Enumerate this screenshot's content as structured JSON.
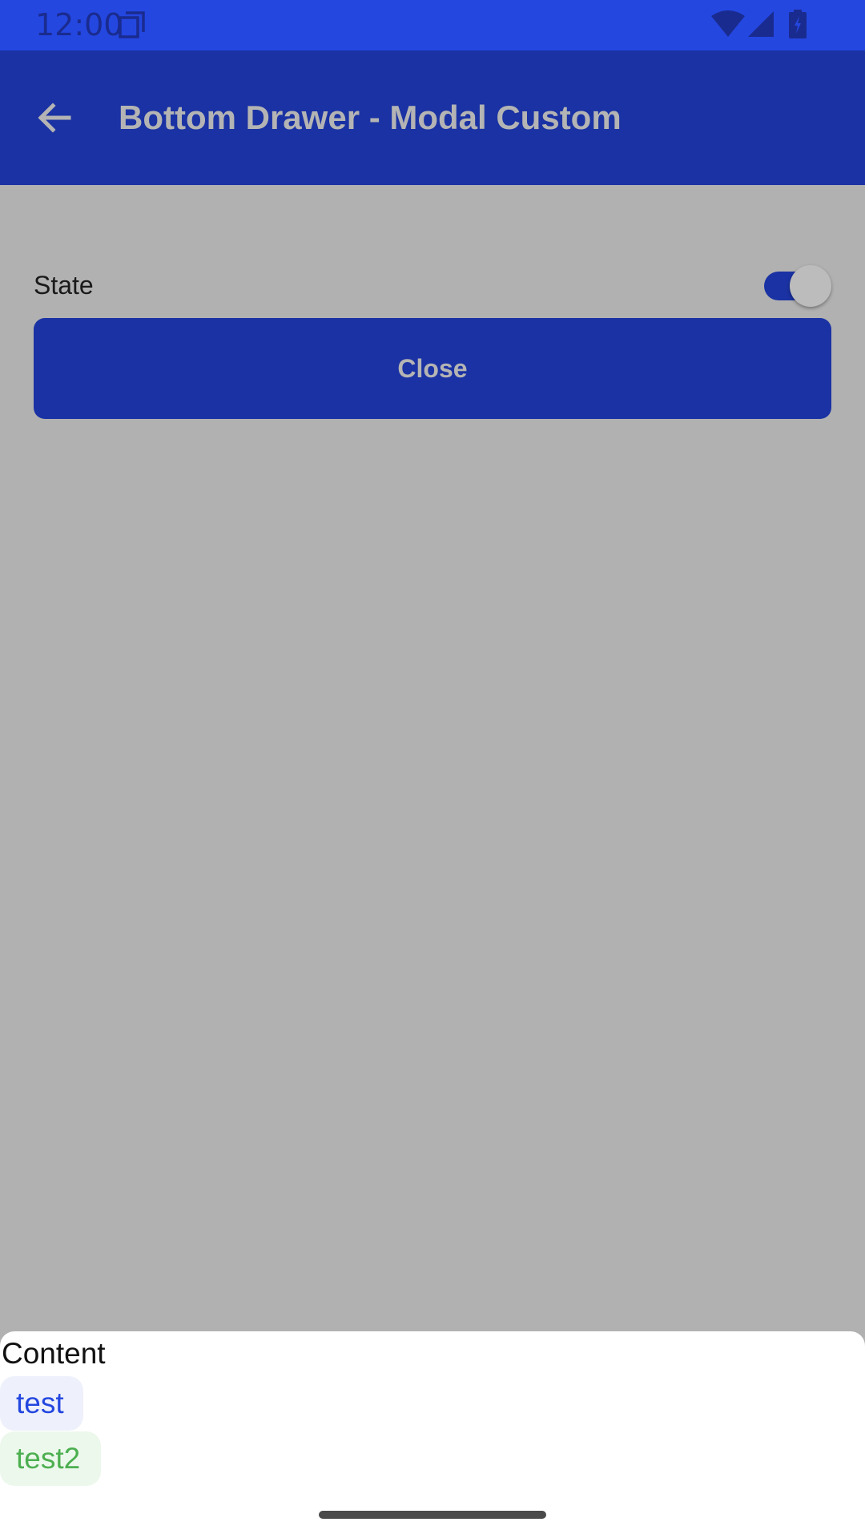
{
  "status_bar": {
    "time": "12:00"
  },
  "app_bar": {
    "title": "Bottom Drawer - Modal Custom"
  },
  "content": {
    "state_label": "State",
    "state_on": true,
    "close_label": "Close"
  },
  "drawer": {
    "title": "Content",
    "items": [
      {
        "label": "test",
        "color": "#2447e0"
      },
      {
        "label": "test2",
        "color": "#4caf50"
      }
    ]
  },
  "colors": {
    "status_bar": "#2447e0",
    "app_bar": "#1a32a3",
    "scrim": "#b1b1b1",
    "drawer": "#ffffff"
  }
}
